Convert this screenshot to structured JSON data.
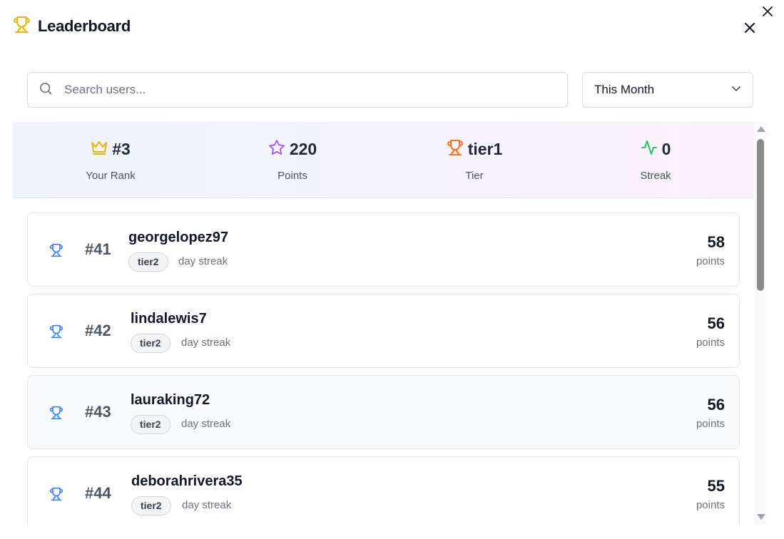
{
  "header": {
    "title": "Leaderboard"
  },
  "search": {
    "placeholder": "Search users..."
  },
  "period": {
    "selected": "This Month"
  },
  "stats": [
    {
      "value": "#3",
      "label": "Your Rank",
      "icon": "crown-icon",
      "color": "#eab308"
    },
    {
      "value": "220",
      "label": "Points",
      "icon": "star-icon",
      "color": "#a855f7"
    },
    {
      "value": "tier1",
      "label": "Tier",
      "icon": "trophy-icon",
      "color": "#f97316"
    },
    {
      "value": "0",
      "label": "Streak",
      "icon": "activity-icon",
      "color": "#22c55e"
    }
  ],
  "entries": [
    {
      "rank": "#41",
      "username": "georgelopez97",
      "tier": "tier2",
      "streak_text": "day streak",
      "points": "58",
      "points_label": "points",
      "icon": "trophy-icon"
    },
    {
      "rank": "#42",
      "username": "lindalewis7",
      "tier": "tier2",
      "streak_text": "day streak",
      "points": "56",
      "points_label": "points",
      "icon": "trophy-icon"
    },
    {
      "rank": "#43",
      "username": "lauraking72",
      "tier": "tier2",
      "streak_text": "day streak",
      "points": "56",
      "points_label": "points",
      "icon": "trophy-icon"
    },
    {
      "rank": "#44",
      "username": "deborahrivera35",
      "tier": "tier2",
      "streak_text": "day streak",
      "points": "55",
      "points_label": "points",
      "icon": "trophy-icon"
    }
  ],
  "colors": {
    "accent": "#3b82f6",
    "header_icon": "#eab308"
  }
}
